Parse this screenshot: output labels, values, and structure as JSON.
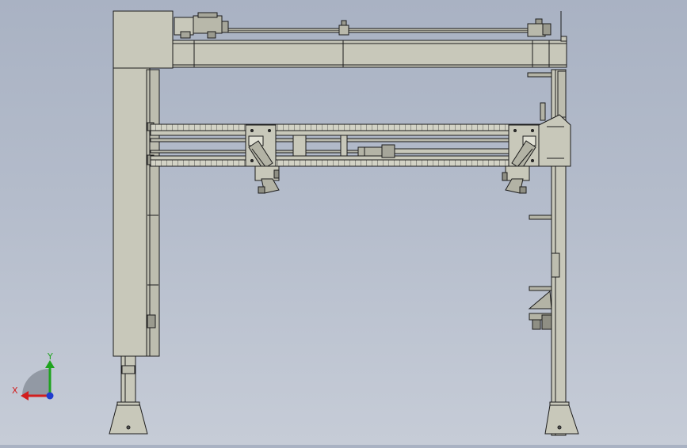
{
  "viewport": {
    "background_top": "#a9b2c3",
    "background_bottom": "#c6ccd7",
    "part_fill": "#c8c8ba",
    "part_fill_dark": "#b3b3a5",
    "edge_color": "#1c1c1c"
  },
  "triad": {
    "y_label": "Y",
    "x_label": "X",
    "y_axis_color": "#1fa31f",
    "x_axis_color": "#d21e1e",
    "z_axis_color": "#1f3ccf",
    "icons": [
      "y-axis-arrow-icon",
      "x-axis-arrow-icon",
      "z-axis-dot-icon"
    ]
  }
}
